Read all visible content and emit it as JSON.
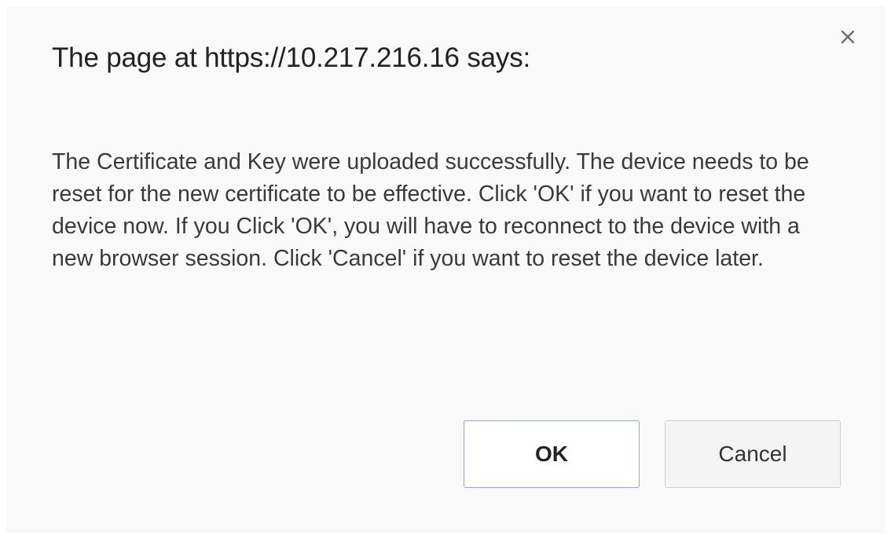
{
  "dialog": {
    "title": "The page at https://10.217.216.16 says:",
    "message": "The Certificate and Key were uploaded successfully. The device needs to be reset for the new certificate to be effective. Click 'OK' if you want to reset the device now. If you Click 'OK', you will have to reconnect to the device with a new browser session. Click 'Cancel' if you want to reset the device later.",
    "close_icon": "close-icon",
    "buttons": {
      "ok_label": "OK",
      "cancel_label": "Cancel"
    }
  },
  "colors": {
    "dialog_background": "#f9f9f9",
    "ok_border": "#8fa9dc",
    "text": "#222222"
  }
}
